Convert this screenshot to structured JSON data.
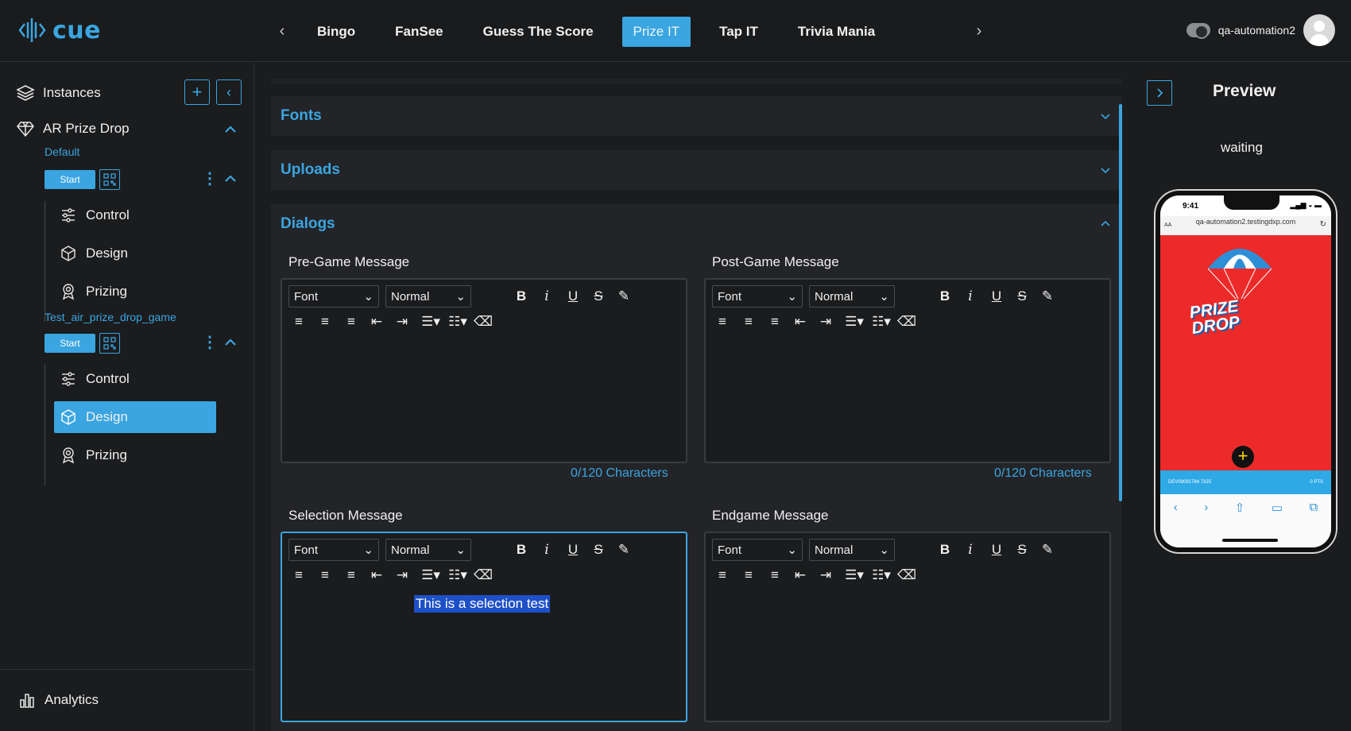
{
  "brand": {
    "logo_text": "cue",
    "accent": "#3aa5e0"
  },
  "topnav": {
    "tabs": [
      "Bingo",
      "FanSee",
      "Guess The Score",
      "Prize IT",
      "Tap IT",
      "Trivia Mania"
    ],
    "active_tab": "Prize IT"
  },
  "user": {
    "name": "qa-automation2"
  },
  "sidebar": {
    "instances_label": "Instances",
    "game_title": "AR Prize Drop",
    "instances": [
      {
        "name": "Default",
        "start_label": "Start",
        "menu": [
          "Control",
          "Design",
          "Prizing"
        ]
      },
      {
        "name": "Test_air_prize_drop_game",
        "start_label": "Start",
        "menu": [
          "Control",
          "Design",
          "Prizing"
        ],
        "active_item": "Design"
      }
    ],
    "footer_label": "Analytics"
  },
  "main": {
    "sections": [
      {
        "title": "Fonts",
        "expanded": false
      },
      {
        "title": "Uploads",
        "expanded": false
      },
      {
        "title": "Dialogs",
        "expanded": true
      }
    ],
    "editors": [
      {
        "label": "Pre-Game Message",
        "font": "Font",
        "size": "Normal",
        "count": "0/120 Characters",
        "content": ""
      },
      {
        "label": "Post-Game Message",
        "font": "Font",
        "size": "Normal",
        "count": "0/120 Characters",
        "content": ""
      },
      {
        "label": "Selection Message",
        "font": "Font",
        "size": "Normal",
        "content": "This is a selection test"
      },
      {
        "label": "Endgame Message",
        "font": "Font",
        "size": "Normal",
        "content": ""
      }
    ]
  },
  "preview": {
    "title": "Preview",
    "status": "waiting",
    "phone": {
      "time": "9:41",
      "url": "qa-automation2.testingdxp.com",
      "aa": "AA",
      "game_title_line1": "PRIZE",
      "game_title_line2": "DROP",
      "band_left": "DEV09091784 7325",
      "band_right": "0 PTS"
    }
  }
}
